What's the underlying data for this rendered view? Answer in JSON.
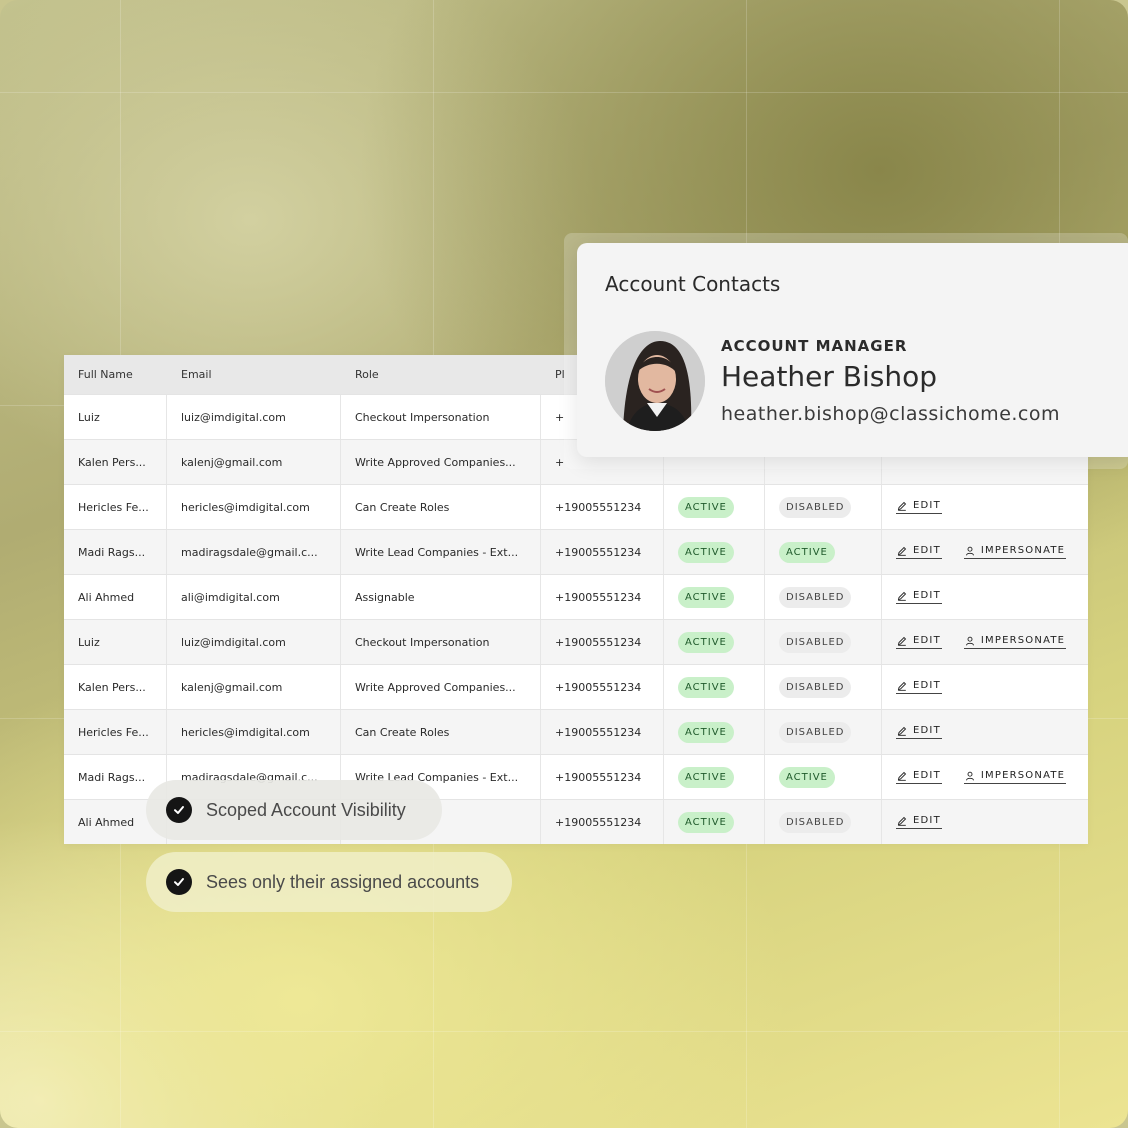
{
  "table": {
    "headers": [
      "Full Name",
      "Email",
      "Role",
      "Pl"
    ],
    "rows": [
      {
        "name": "Luiz",
        "email": "luiz@imdigital.com",
        "role": "Checkout Impersonation",
        "phone": "+",
        "status": "",
        "status2": "",
        "actions": []
      },
      {
        "name": "Kalen Pers...",
        "email": "kalenj@gmail.com",
        "role": "Write Approved Companies...",
        "phone": "+",
        "status": "",
        "status2": "",
        "actions": []
      },
      {
        "name": "Hericles Fe...",
        "email": "hericles@imdigital.com",
        "role": "Can Create Roles",
        "phone": "+19005551234",
        "status": "ACTIVE",
        "status2": "DISABLED",
        "actions": [
          "EDIT"
        ]
      },
      {
        "name": "Madi Rags...",
        "email": "madiragsdale@gmail.c...",
        "role": "Write Lead Companies - Ext...",
        "phone": "+19005551234",
        "status": "ACTIVE",
        "status2": "ACTIVE",
        "actions": [
          "EDIT",
          "IMPERSONATE"
        ]
      },
      {
        "name": "Ali Ahmed",
        "email": "ali@imdigital.com",
        "role": "Assignable",
        "phone": "+19005551234",
        "status": "ACTIVE",
        "status2": "DISABLED",
        "actions": [
          "EDIT"
        ]
      },
      {
        "name": "Luiz",
        "email": "luiz@imdigital.com",
        "role": "Checkout Impersonation",
        "phone": "+19005551234",
        "status": "ACTIVE",
        "status2": "DISABLED",
        "actions": [
          "EDIT",
          "IMPERSONATE"
        ]
      },
      {
        "name": "Kalen Pers...",
        "email": "kalenj@gmail.com",
        "role": "Write Approved Companies...",
        "phone": "+19005551234",
        "status": "ACTIVE",
        "status2": "DISABLED",
        "actions": [
          "EDIT"
        ]
      },
      {
        "name": "Hericles Fe...",
        "email": "hericles@imdigital.com",
        "role": "Can Create Roles",
        "phone": "+19005551234",
        "status": "ACTIVE",
        "status2": "DISABLED",
        "actions": [
          "EDIT"
        ]
      },
      {
        "name": "Madi Rags...",
        "email": "madiragsdale@gmail.c...",
        "role": "Write Lead Companies - Ext...",
        "phone": "+19005551234",
        "status": "ACTIVE",
        "status2": "ACTIVE",
        "actions": [
          "EDIT",
          "IMPERSONATE"
        ]
      },
      {
        "name": "Ali Ahmed",
        "email": "",
        "role": "",
        "phone": "+19005551234",
        "status": "ACTIVE",
        "status2": "DISABLED",
        "actions": [
          "EDIT"
        ]
      }
    ]
  },
  "contact_card": {
    "title": "Account Contacts",
    "role_label": "ACCOUNT MANAGER",
    "name": "Heather Bishop",
    "email": "heather.bishop@classichome.com"
  },
  "features": [
    {
      "label": "Scoped Account Visibility",
      "icon": "check-icon"
    },
    {
      "label": "Sees only their assigned accounts",
      "icon": "check-icon"
    }
  ],
  "colors": {
    "active_pill_bg": "#c9f0c9",
    "disabled_pill_bg": "#ececec",
    "check_bg": "#151515"
  }
}
